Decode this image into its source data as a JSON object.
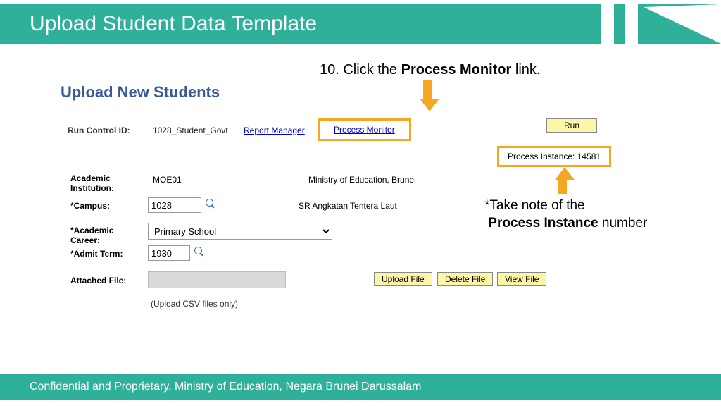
{
  "slide_title": "Upload Student Data Template",
  "footer": "Confidential and Proprietary, Ministry of Education, Negara Brunei Darussalam",
  "instruction": {
    "prefix": "10. Click the ",
    "bold": "Process Monitor",
    "suffix": " link."
  },
  "page_heading": "Upload New Students",
  "run_control": {
    "label": "Run Control ID:",
    "value": "1028_Student_Govt"
  },
  "links": {
    "report_manager": "Report Manager",
    "process_monitor": "Process Monitor"
  },
  "run_button": "Run",
  "process_instance": {
    "label": "Process Instance:",
    "value": "14581"
  },
  "note": {
    "line1_prefix": "*Take note of the",
    "line2_bold": "Process Instance",
    "line2_suffix": " number"
  },
  "fields": {
    "academic_institution": {
      "label": "Academic Institution:",
      "value": "MOE01",
      "desc": "Ministry of Education, Brunei"
    },
    "campus": {
      "label": "*Campus:",
      "value": "1028",
      "desc": "SR Angkatan Tentera Laut"
    },
    "academic_career": {
      "label": "*Academic Career:",
      "value": "Primary School"
    },
    "admit_term": {
      "label": "*Admit Term:",
      "value": "1930"
    },
    "attached_file": {
      "label": "Attached File:"
    }
  },
  "buttons": {
    "upload": "Upload File",
    "delete": "Delete File",
    "view": "View File"
  },
  "csv_note": "(Upload CSV files only)"
}
